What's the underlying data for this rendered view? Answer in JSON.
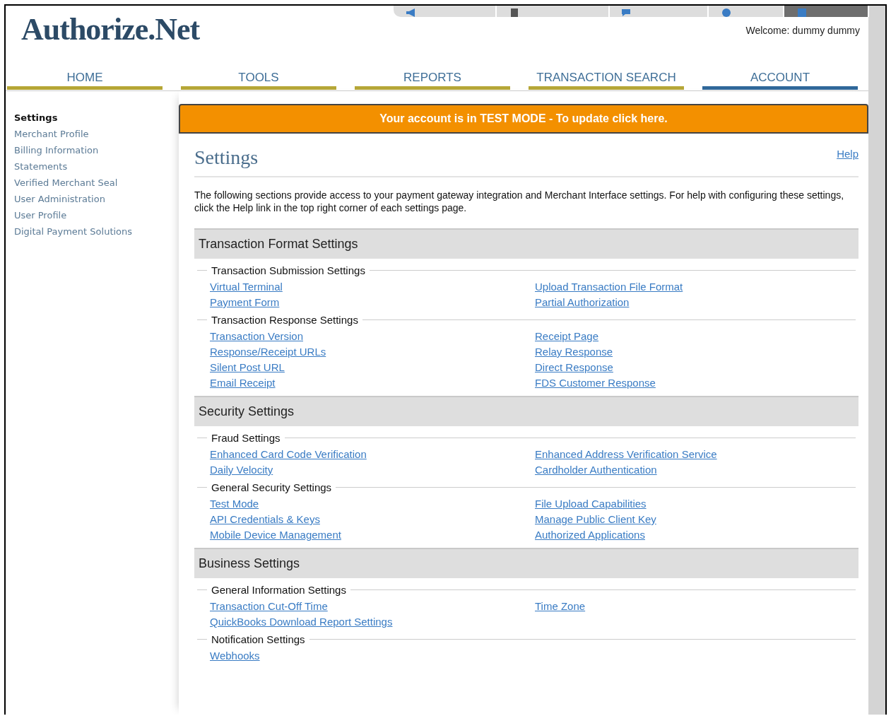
{
  "header": {
    "logo": "Authorize.Net",
    "welcome": "Welcome: dummy dummy"
  },
  "nav": [
    {
      "label": "HOME",
      "selected": false
    },
    {
      "label": "TOOLS",
      "selected": false
    },
    {
      "label": "REPORTS",
      "selected": false
    },
    {
      "label": "TRANSACTION SEARCH",
      "selected": false
    },
    {
      "label": "ACCOUNT",
      "selected": true
    }
  ],
  "sidebar": {
    "heading": "Settings",
    "items": [
      "Merchant Profile",
      "Billing Information",
      "Statements",
      "Verified Merchant Seal",
      "User Administration",
      "User Profile",
      "Digital Payment Solutions"
    ]
  },
  "banner": "Your account is in TEST MODE - To update click here.",
  "page": {
    "title": "Settings",
    "help": "Help",
    "intro": "The following sections provide access to your payment gateway integration and Merchant Interface settings. For help with configuring these settings, click the Help link in the top right corner of each settings page."
  },
  "sections": [
    {
      "title": "Transaction Format Settings",
      "groups": [
        {
          "title": "Transaction Submission Settings",
          "rows": [
            [
              "Virtual Terminal",
              "Upload Transaction File Format"
            ],
            [
              "Payment Form",
              "Partial Authorization"
            ]
          ]
        },
        {
          "title": "Transaction Response Settings",
          "rows": [
            [
              "Transaction Version",
              "Receipt Page"
            ],
            [
              "Response/Receipt URLs",
              "Relay Response"
            ],
            [
              "Silent Post URL",
              "Direct Response"
            ],
            [
              "Email Receipt",
              "FDS Customer Response"
            ]
          ]
        }
      ]
    },
    {
      "title": "Security Settings",
      "groups": [
        {
          "title": "Fraud Settings",
          "rows": [
            [
              "Enhanced Card Code Verification",
              "Enhanced Address Verification Service"
            ],
            [
              "Daily Velocity",
              "Cardholder Authentication"
            ]
          ]
        },
        {
          "title": "General Security Settings",
          "rows": [
            [
              "Test Mode",
              "File Upload Capabilities"
            ],
            [
              "API Credentials & Keys",
              "Manage Public Client Key"
            ],
            [
              "Mobile Device Management",
              "Authorized Applications"
            ]
          ]
        }
      ]
    },
    {
      "title": "Business Settings",
      "groups": [
        {
          "title": "General Information Settings",
          "rows": [
            [
              "Transaction Cut-Off Time",
              "Time Zone"
            ],
            [
              "QuickBooks Download Report Settings"
            ]
          ]
        },
        {
          "title": "Notification Settings",
          "rows": [
            [
              "Webhooks"
            ]
          ]
        }
      ]
    }
  ]
}
